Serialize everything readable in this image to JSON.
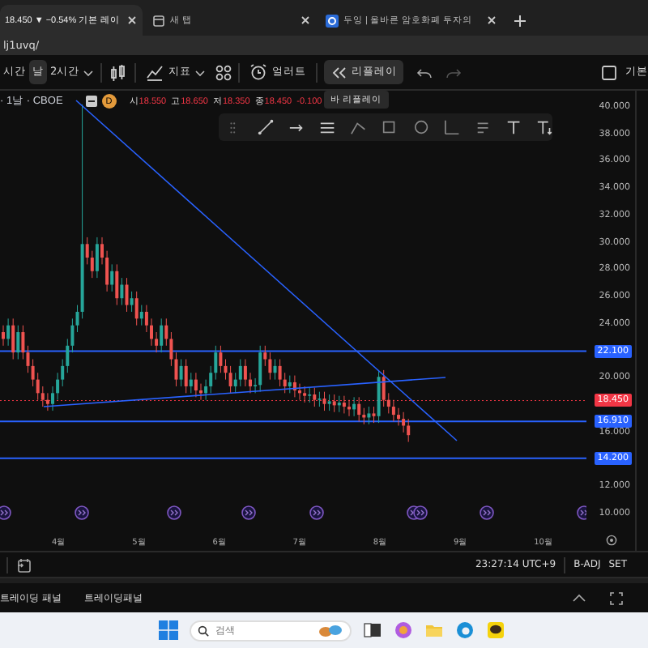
{
  "browser_tabs": [
    {
      "title": "18.450 ▼ −0.54% 기본 레이",
      "selected": true
    },
    {
      "title": "새 탭",
      "selected": false
    },
    {
      "title": "두잉 | 올바른 암호화폐 투자의",
      "selected": false
    }
  ],
  "address": "lj1uvq/",
  "intervals": [
    {
      "label": "시간",
      "selected": false
    },
    {
      "label": "날",
      "selected": true
    },
    {
      "label": "2시간",
      "selected": false
    }
  ],
  "indicators_label": "지표",
  "alert_label": "얼러트",
  "replay": {
    "label": "리플레이",
    "active": true
  },
  "tooltip": "바 리플레이",
  "layout_label": "기본",
  "legend": {
    "symbol": "· 1날 · CBOE",
    "interval_badge": "D",
    "ohlc": [
      {
        "name": "시",
        "value": "18.550"
      },
      {
        "name": "고",
        "value": "18.650"
      },
      {
        "name": "저",
        "value": "18.350"
      },
      {
        "name": "종",
        "value": "18.450"
      }
    ],
    "change": "-0.100"
  },
  "price_axis": [
    "40.000",
    "38.000",
    "36.000",
    "34.000",
    "32.000",
    "30.000",
    "28.000",
    "26.000",
    "24.000",
    "20.000",
    "16.000",
    "12.000",
    "10.000"
  ],
  "price_lines": [
    {
      "label": "22.100",
      "kind": "level"
    },
    {
      "label": "18.450",
      "kind": "last"
    },
    {
      "label": "16.910",
      "kind": "level"
    },
    {
      "label": "14.200",
      "kind": "level"
    }
  ],
  "time_axis": [
    "4월",
    "5월",
    "6월",
    "7월",
    "8월",
    "9월",
    "10월"
  ],
  "status": {
    "time": "23:27:14 UTC+9",
    "adjust": "B-ADJ",
    "session": "SET"
  },
  "panel_tabs": [
    "트레이딩 패널",
    "트레이딩패널"
  ],
  "taskbar": {
    "search_placeholder": "검색"
  }
}
